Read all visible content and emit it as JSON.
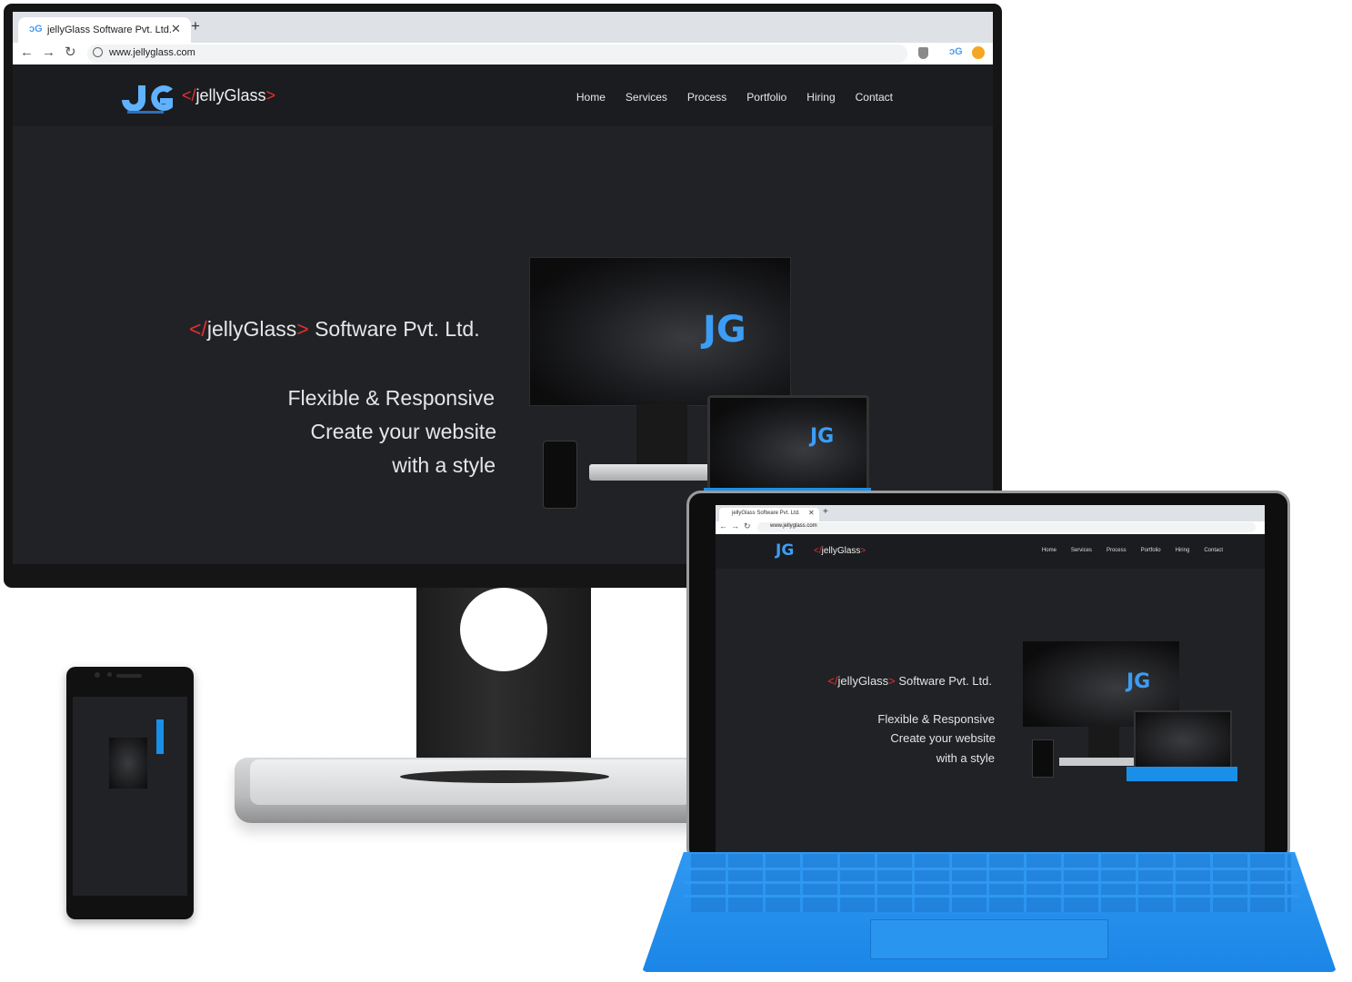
{
  "browser": {
    "tab_title": "jellyGlass Software Pvt. Ltd.",
    "url": "www.jellyglass.com"
  },
  "site": {
    "logo_prefix": "</",
    "logo_name": "jellyGlass",
    "logo_suffix": ">",
    "logo_monogram": "JG",
    "nav": [
      "Home",
      "Services",
      "Process",
      "Portfolio",
      "Hiring",
      "Contact"
    ],
    "hero_company_name": "Software Pvt. Ltd.",
    "hero_lines": [
      "Flexible & Responsive",
      "Create your website",
      "with a style"
    ]
  },
  "colors": {
    "background": "#212226",
    "accent_red": "#e2312f",
    "accent_blue": "#3b9df5",
    "keyboard_blue": "#1a8fe8"
  }
}
